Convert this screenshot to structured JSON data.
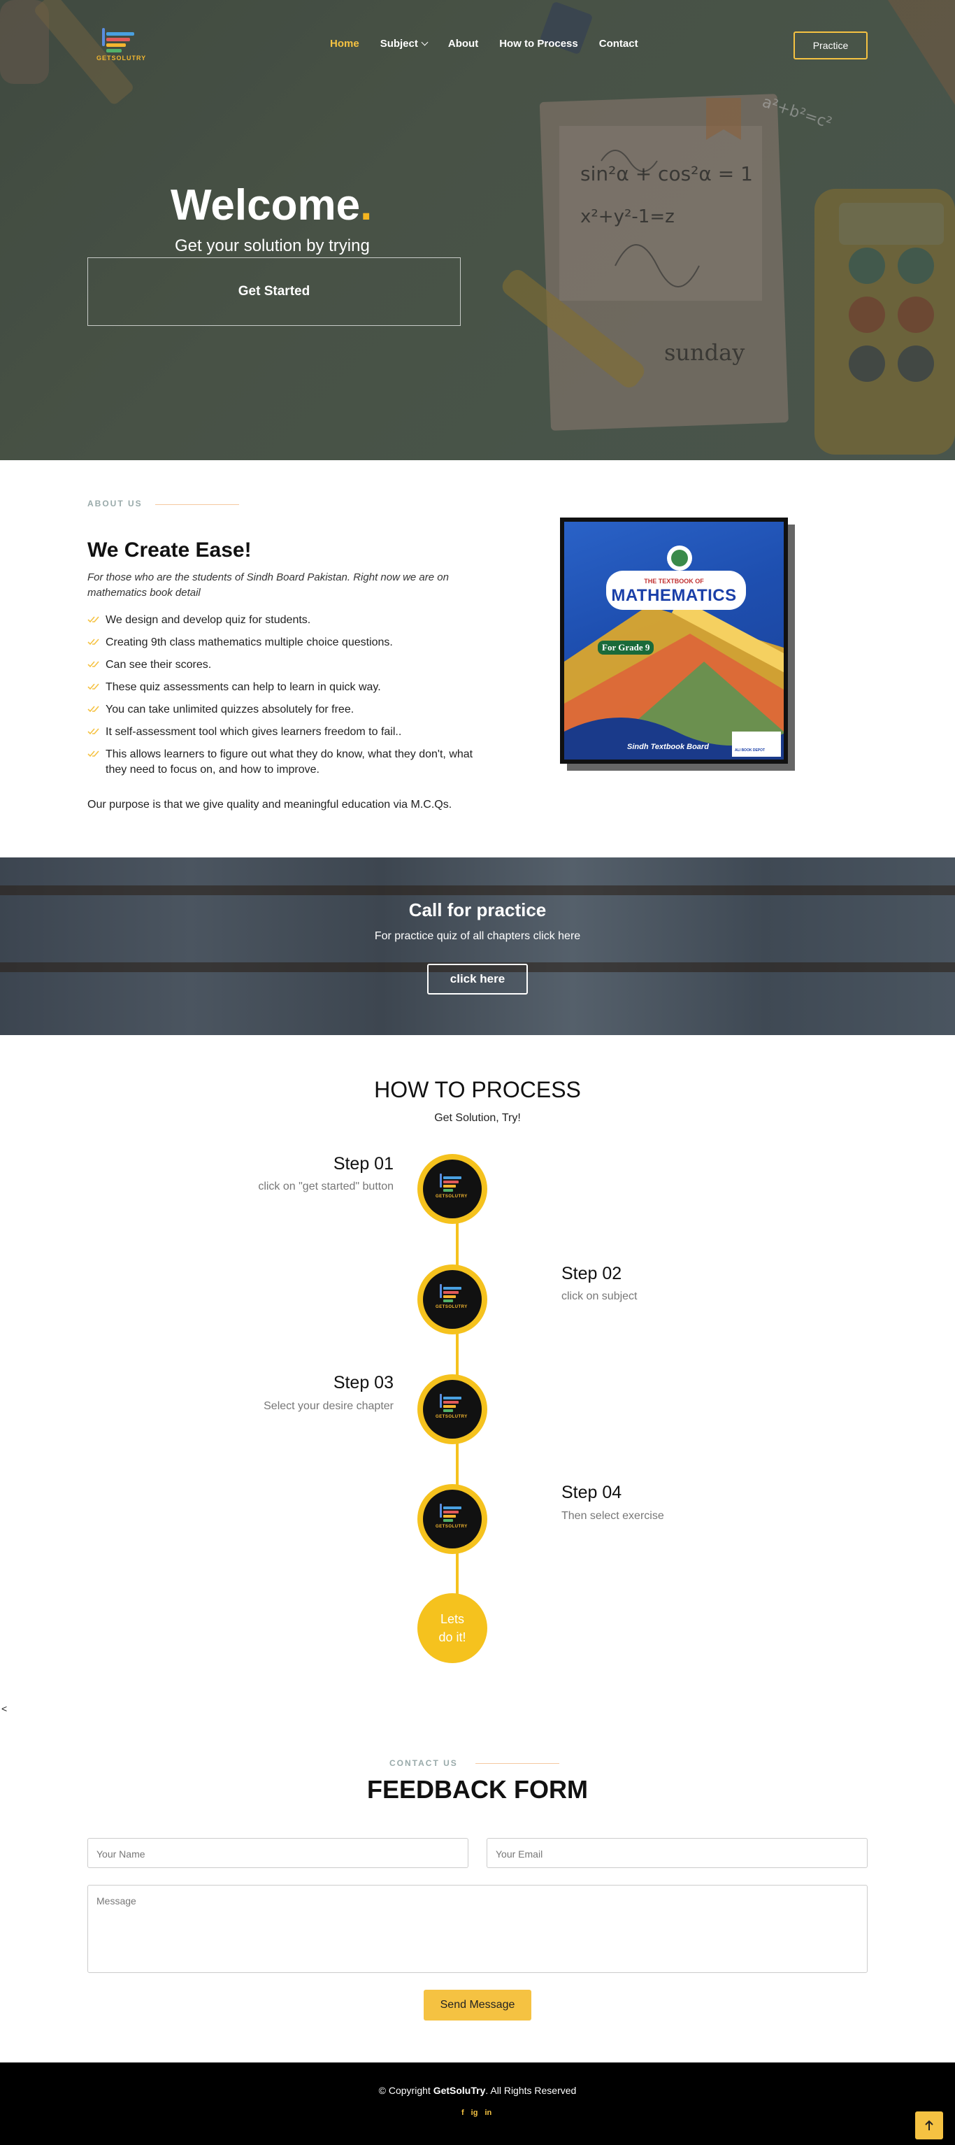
{
  "brand": {
    "logo_text": "GETSOLUTRY"
  },
  "nav": {
    "items": [
      {
        "label": "Home",
        "active": true
      },
      {
        "label": "Subject",
        "has_dropdown": true
      },
      {
        "label": "About"
      },
      {
        "label": "How to Process"
      },
      {
        "label": "Contact"
      }
    ],
    "practice_label": "Practice"
  },
  "hero": {
    "title": "Welcome.",
    "title_dot": ".",
    "subtitle": "Get your solution by trying",
    "cta_label": "Get Started",
    "doodles": [
      "sin²α + cos²α = 1",
      "x²+y²-1=z",
      "sunday",
      "a²+b²=c²"
    ]
  },
  "about": {
    "label": "ABOUT US",
    "heading": "We Create Ease!",
    "intro": "For those who are the students of Sindh Board Pakistan. Right now we are on mathematics book detail",
    "points": [
      "We design and develop quiz for students.",
      "Creating 9th class mathematics multiple choice questions.",
      "Can see their scores.",
      "These quiz assessments can help to learn in quick way.",
      "You can take unlimited quizzes absolutely for free.",
      "It self-assessment tool which gives learners freedom to fail..",
      "This allows learners to figure out what they do know, what they don't, what they need to focus on, and how to improve."
    ],
    "purpose": "Our purpose is that we give quality and meaningful education via M.C.Qs.",
    "book": {
      "top": "THE TEXTBOOK OF",
      "title": "MATHEMATICS",
      "grade": "For Grade 9",
      "board": "Sindh Textbook Board",
      "publisher": "ALI BOOK DEPOT"
    }
  },
  "call_practice": {
    "title": "Call for practice",
    "subtitle": "For practice quiz of all chapters click here",
    "button": "click here"
  },
  "how_to_process": {
    "title": "HOW TO PROCESS",
    "subtitle": "Get Solution, Try!",
    "steps": [
      {
        "title": "Step 01",
        "desc": "click on \"get started\" button"
      },
      {
        "title": "Step 02",
        "desc": "click on subject"
      },
      {
        "title": "Step 03",
        "desc": "Select your desire chapter"
      },
      {
        "title": "Step 04",
        "desc": "Then select exercise"
      }
    ],
    "final": [
      "Lets",
      "do it!"
    ],
    "stray_char": "<"
  },
  "contact": {
    "label": "CONTACT US",
    "heading": "FEEDBACK FORM",
    "name_placeholder": "Your Name",
    "email_placeholder": "Your Email",
    "message_placeholder": "Message",
    "send_label": "Send Message"
  },
  "footer": {
    "copy_prefix": "© Copyright ",
    "copy_brand": "GetSoluTry",
    "copy_suffix": ". All Rights Reserved",
    "socials": [
      "f",
      "ig",
      "in"
    ],
    "to_top_icon": "arrow-up-icon"
  },
  "colors": {
    "accent": "#f5c242",
    "timeline": "#f5c21e",
    "footer_bg": "#000000"
  }
}
